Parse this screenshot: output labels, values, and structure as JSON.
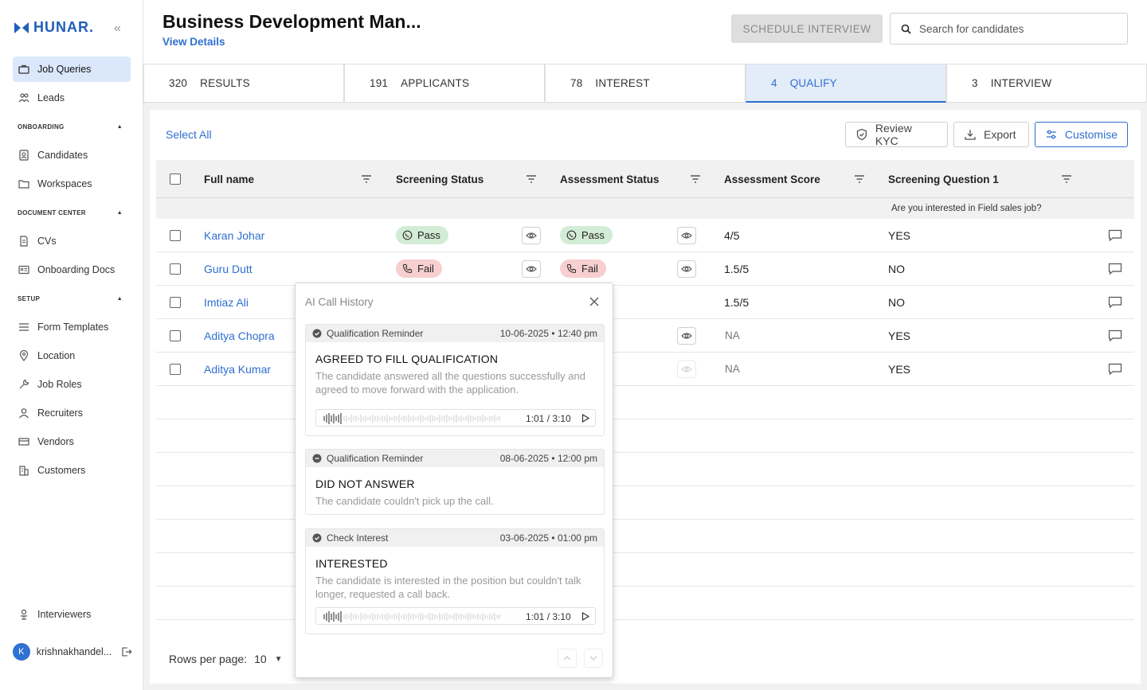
{
  "app": {
    "logo": "HUNAR.",
    "colors": {
      "accent": "#2e6fd0",
      "pass_bg": "#d3ecd5",
      "fail_bg": "#f7cfcf",
      "whatsapp": "#2a8a3a",
      "phone": "#c23b3b"
    }
  },
  "sidebar": {
    "items": [
      {
        "label": "Job Queries",
        "icon": "briefcase-icon",
        "active": true
      },
      {
        "label": "Leads",
        "icon": "users-icon"
      }
    ],
    "sections": [
      {
        "title": "ONBOARDING",
        "items": [
          {
            "label": "Candidates",
            "icon": "contact-icon"
          },
          {
            "label": "Workspaces",
            "icon": "folder-icon"
          }
        ]
      },
      {
        "title": "DOCUMENT CENTER",
        "items": [
          {
            "label": "CVs",
            "icon": "document-icon"
          },
          {
            "label": "Onboarding Docs",
            "icon": "id-card-icon"
          }
        ]
      },
      {
        "title": "SETUP",
        "items": [
          {
            "label": "Form Templates",
            "icon": "list-icon"
          },
          {
            "label": "Location",
            "icon": "location-icon"
          },
          {
            "label": "Job Roles",
            "icon": "wrench-icon"
          },
          {
            "label": "Recruiters",
            "icon": "person-icon"
          },
          {
            "label": "Vendors",
            "icon": "store-icon"
          },
          {
            "label": "Customers",
            "icon": "building-icon"
          }
        ]
      }
    ],
    "interviewers": "Interviewers",
    "user": {
      "initial": "K",
      "name": "krishnakhandel..."
    }
  },
  "header": {
    "title": "Business Development Man...",
    "view_details": "View Details",
    "schedule_button": "SCHEDULE INTERVIEW",
    "search_placeholder": "Search for candidates"
  },
  "tabs": [
    {
      "count": "320",
      "label": "RESULTS"
    },
    {
      "count": "191",
      "label": "APPLICANTS"
    },
    {
      "count": "78",
      "label": "INTEREST"
    },
    {
      "count": "4",
      "label": "QUALIFY",
      "active": true
    },
    {
      "count": "3",
      "label": "INTERVIEW"
    }
  ],
  "toolbar": {
    "select_all": "Select All",
    "review_kyc": "Review KYC",
    "export": "Export",
    "customise": "Customise"
  },
  "table": {
    "columns": [
      "Full name",
      "Screening Status",
      "Assessment Status",
      "Assessment Score",
      "Screening Question 1"
    ],
    "question_1": "Are you interested in Field sales job?",
    "rows": [
      {
        "name": "Karan Johar",
        "screening": "Pass",
        "assessment": "Pass",
        "score": "4/5",
        "answer": "YES"
      },
      {
        "name": "Guru Dutt",
        "screening": "Fail",
        "assessment": "Fail",
        "score": "1.5/5",
        "answer": "NO"
      },
      {
        "name": "Imtiaz Ali",
        "score": "1.5/5",
        "answer": "NO"
      },
      {
        "name": "Aditya Chopra",
        "score": "NA",
        "answer": "YES"
      },
      {
        "name": "Aditya Kumar",
        "score": "NA",
        "answer": "YES"
      }
    ],
    "rows_per_page_label": "Rows per page:",
    "rows_per_page_value": "10"
  },
  "popup": {
    "title": "AI Call History",
    "calls": [
      {
        "type": "Qualification Reminder",
        "datetime": "10-06-2025 • 12:40 pm",
        "status": "AGREED TO FILL QUALIFICATION",
        "desc": "The candidate answered all the questions successfully and agreed to move forward with the application.",
        "time": "1:01 / 3:10"
      },
      {
        "type": "Qualification Reminder",
        "datetime": "08-06-2025 • 12:00 pm",
        "status": "DID NOT ANSWER",
        "desc": "The candidate couldn't pick up the call."
      },
      {
        "type": "Check Interest",
        "datetime": "03-06-2025 • 01:00 pm",
        "status": "INTERESTED",
        "desc": "The candidate is interested in the position but couldn't talk longer, requested a call back.",
        "time": "1:01 / 3:10"
      }
    ]
  }
}
